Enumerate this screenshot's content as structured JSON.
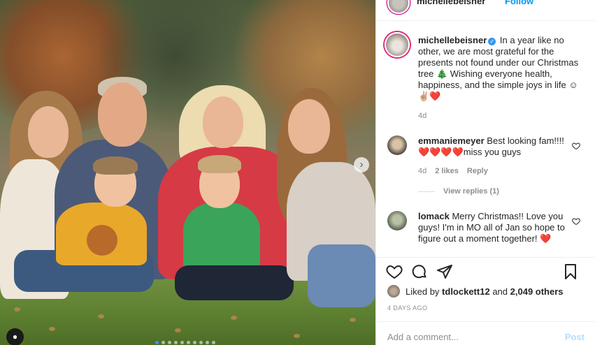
{
  "header": {
    "username": "michellebeisner",
    "follow_label": "Follow"
  },
  "caption": {
    "username": "michellebeisner",
    "text": "In a year like no other, we are most grateful for the presents not found under our Christmas tree 🎄 Wishing everyone health, happiness, and the simple joys in life ☺✌🏼❤️",
    "time": "4d"
  },
  "comments": [
    {
      "username": "emmaniemeyer",
      "text": "Best looking fam!!!!❤️❤️❤️❤️miss you guys",
      "time": "4d",
      "likes": "2 likes",
      "reply_label": "Reply",
      "view_replies": "View replies (1)"
    },
    {
      "username": "lomack",
      "text": "Merry Christmas!! Love you guys! I'm in MO all of Jan so hope to figure out a moment together! ❤️"
    }
  ],
  "likes": {
    "prefix": "Liked by",
    "user": "tdlockett12",
    "joiner": "and",
    "others": "2,049 others"
  },
  "posted_ago": "4 DAYS AGO",
  "add_comment": {
    "placeholder": "Add a comment...",
    "post_label": "Post"
  },
  "carousel": {
    "slide_count": 10,
    "active_index": 0
  },
  "colors": {
    "link_blue": "#0095f6",
    "post_disabled": "#b2dffc",
    "verified": "#3897f0",
    "heart_red": "#ed4956"
  }
}
